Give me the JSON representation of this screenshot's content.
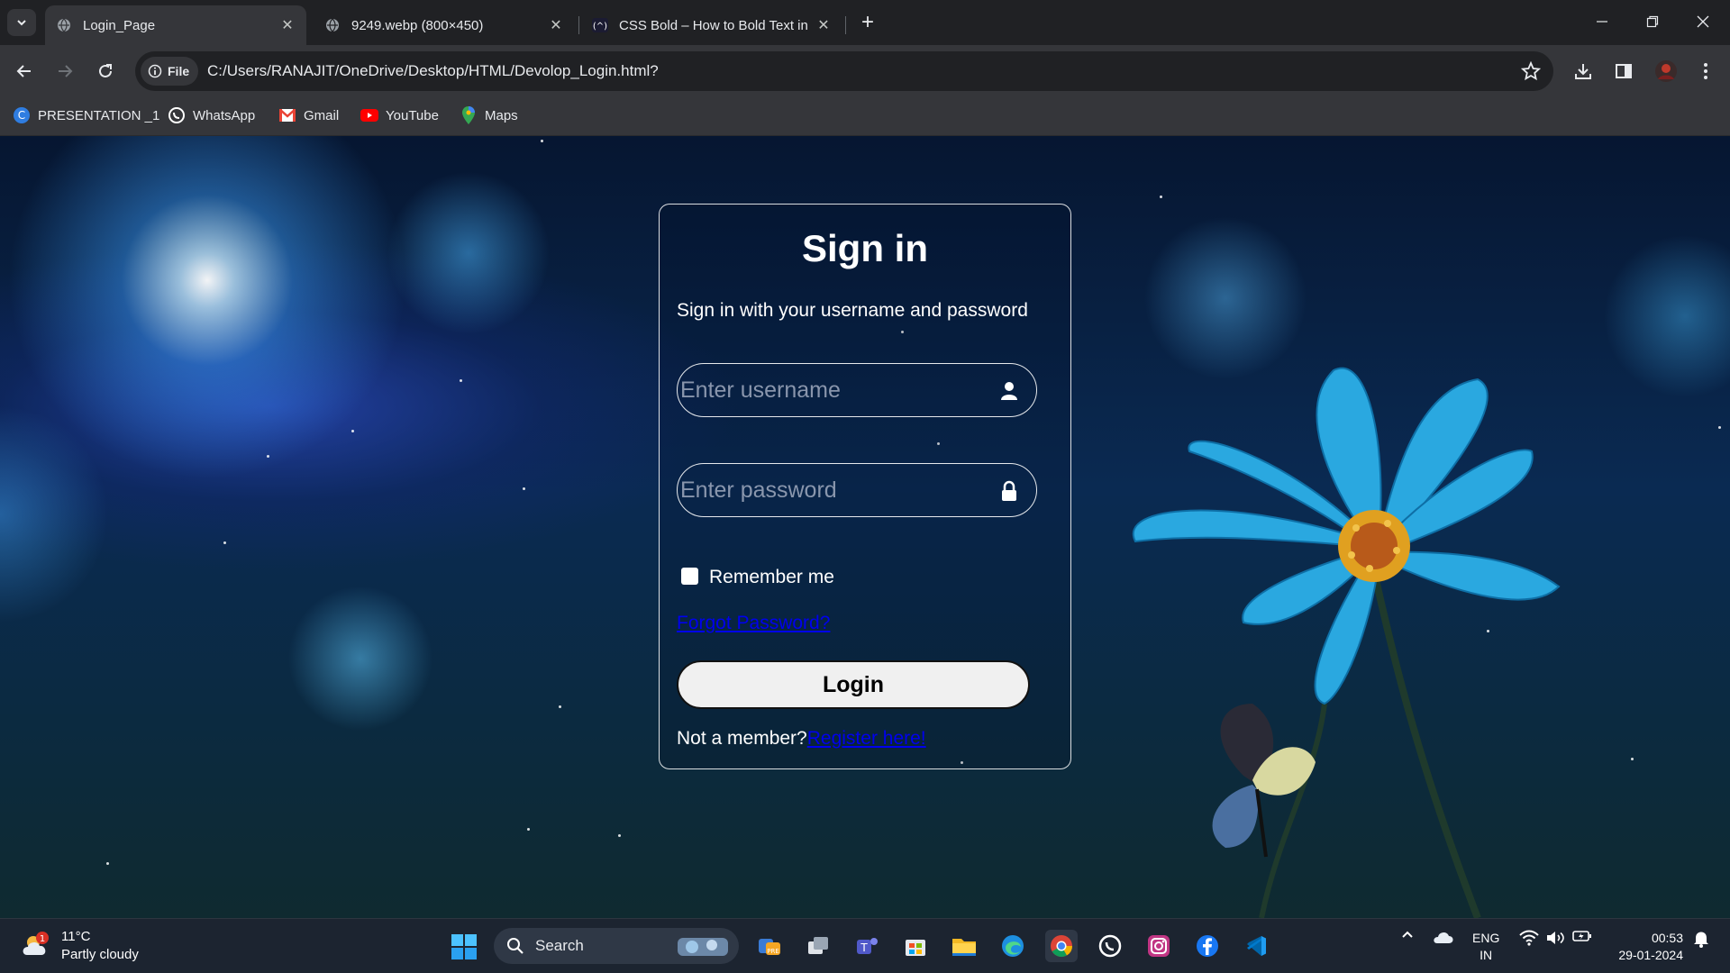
{
  "tabs": [
    {
      "title": "Login_Page",
      "active": true
    },
    {
      "title": "9249.webp (800×450)",
      "active": false
    },
    {
      "title": "CSS Bold – How to Bold Text in",
      "active": false
    }
  ],
  "toolbar": {
    "chip_label": "File",
    "url": "C:/Users/RANAJIT/OneDrive/Desktop/HTML/Devolop_Login.html?"
  },
  "bookmarks": [
    {
      "label": "PRESENTATION _1",
      "icon": "canva-icon"
    },
    {
      "label": "WhatsApp",
      "icon": "whatsapp-icon"
    },
    {
      "label": "Gmail",
      "icon": "gmail-icon"
    },
    {
      "label": "YouTube",
      "icon": "youtube-icon"
    },
    {
      "label": "Maps",
      "icon": "maps-icon"
    }
  ],
  "login": {
    "title": "Sign in",
    "subtitle": "Sign in with your username and password",
    "username_placeholder": "Enter username",
    "password_placeholder": "Enter password",
    "remember_label": "Remember me",
    "remember_checked": false,
    "forgot_link": "Forgot Password?",
    "login_button": "Login",
    "register_prompt": "Not a member?",
    "register_link": "Register here!"
  },
  "taskbar": {
    "weather_temp": "11°C",
    "weather_desc": "Partly cloudy",
    "weather_badge": "1",
    "search_label": "Search",
    "lang_line1": "ENG",
    "lang_line2": "IN",
    "time": "00:53",
    "date": "29-01-2024"
  },
  "colors": {
    "browser_frame": "#202124",
    "toolbar": "#35363a",
    "link": "#0000ee",
    "taskbar": "#1c2430"
  }
}
